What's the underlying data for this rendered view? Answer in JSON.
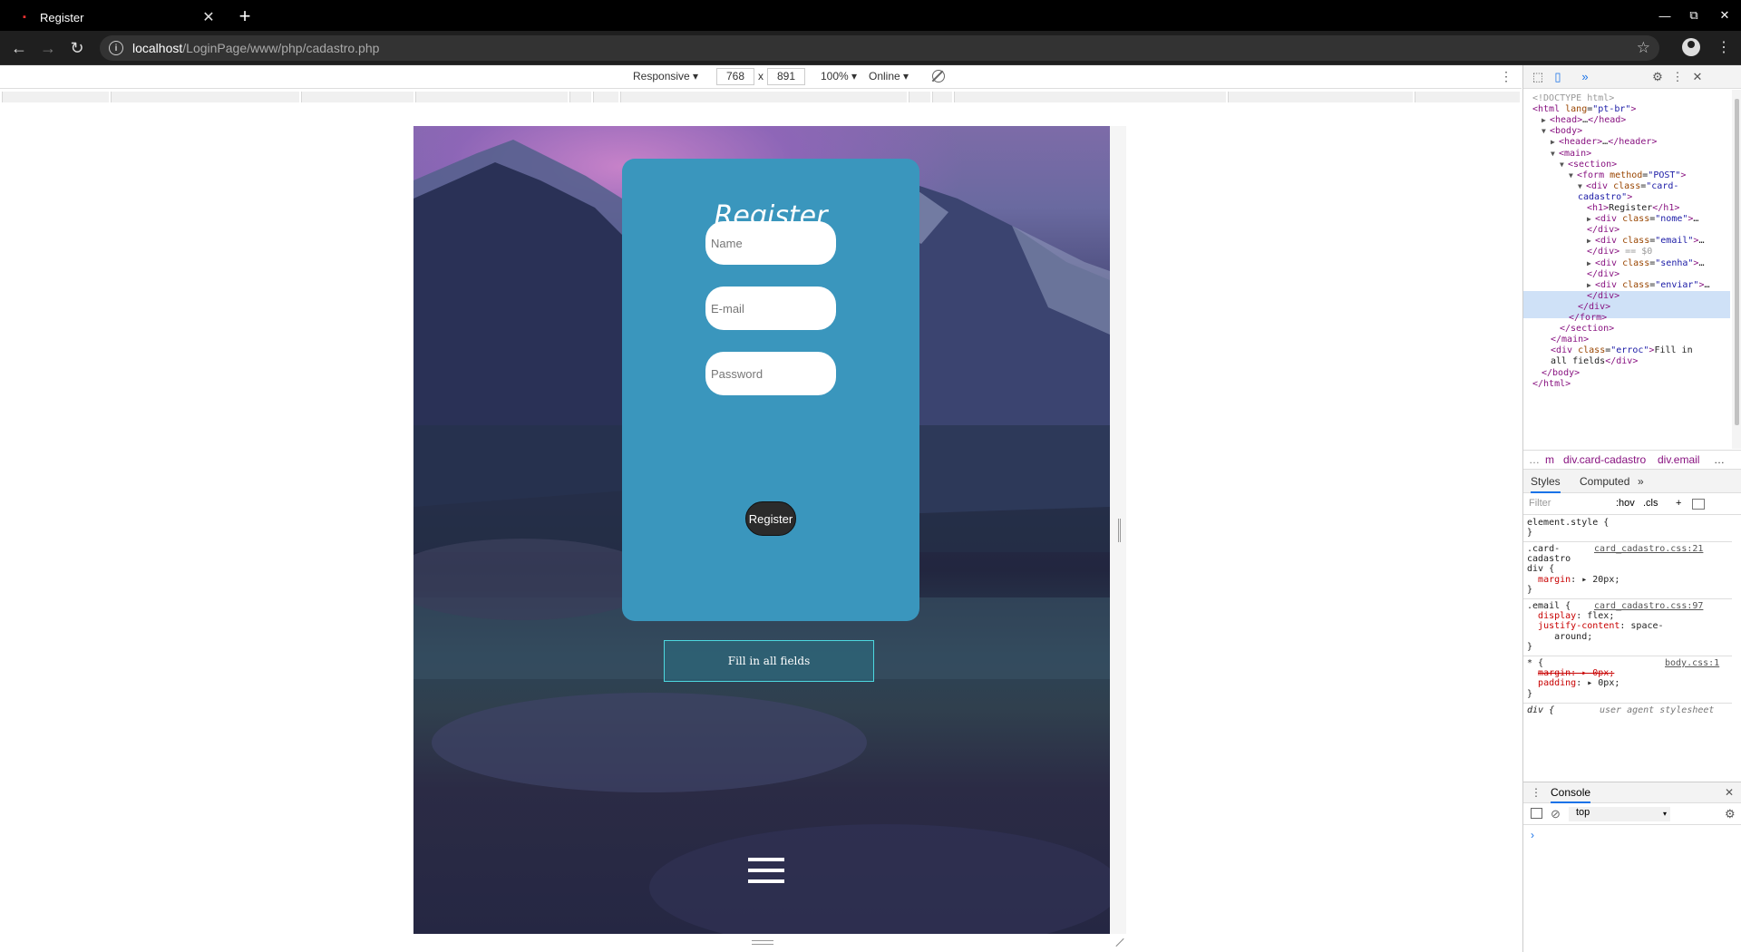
{
  "browser": {
    "tab_title": "Register",
    "tab_close": "✕",
    "new_tab": "+",
    "url_host": "localhost",
    "url_path": "/LoginPage/www/php/cadastro.php",
    "win_min": "—",
    "win_restore": "⧉",
    "win_close": "✕"
  },
  "device_toolbar": {
    "device": "Responsive ▾",
    "width": "768",
    "times": "x",
    "height": "891",
    "zoom": "100% ▾",
    "network": "Online ▾"
  },
  "page": {
    "heading": "Register",
    "name_placeholder": "Name",
    "email_placeholder": "E-mail",
    "password_placeholder": "Password",
    "submit_label": "Register",
    "error_message": "Fill in all fields"
  },
  "devtools": {
    "dom": [
      {
        "indent": 0,
        "html": "<span class=\"cmt\">&lt;!DOCTYPE html&gt;</span>"
      },
      {
        "indent": 0,
        "html": "<span class=\"tag\">&lt;html</span> <span class=\"attr\">lang</span>=<span class=\"val\">\"pt-br\"</span><span class=\"tag\">&gt;</span>"
      },
      {
        "indent": 1,
        "html": "<span class=\"tri\">▶</span><span class=\"tag\">&lt;head&gt;</span>…<span class=\"tag\">&lt;/head&gt;</span>"
      },
      {
        "indent": 1,
        "html": "<span class=\"tri\">▼</span><span class=\"tag\">&lt;body&gt;</span>"
      },
      {
        "indent": 2,
        "html": "<span class=\"tri\">▶</span><span class=\"tag\">&lt;header&gt;</span>…<span class=\"tag\">&lt;/header&gt;</span>"
      },
      {
        "indent": 2,
        "html": "<span class=\"tri\">▼</span><span class=\"tag\">&lt;main&gt;</span>"
      },
      {
        "indent": 3,
        "html": "<span class=\"tri\">▼</span><span class=\"tag\">&lt;section&gt;</span>"
      },
      {
        "indent": 4,
        "html": "<span class=\"tri\">▼</span><span class=\"tag\">&lt;form</span> <span class=\"attr\">method</span>=<span class=\"val\">\"POST\"</span><span class=\"tag\">&gt;</span>"
      },
      {
        "indent": 5,
        "html": "<span class=\"tri\">▼</span><span class=\"tag\">&lt;div</span> <span class=\"attr\">class</span>=<span class=\"val\">\"card-</span>"
      },
      {
        "indent": 5,
        "html": "<span class=\"val\">cadastro\"</span><span class=\"tag\">&gt;</span>"
      },
      {
        "indent": 6,
        "html": "<span class=\"tag\">&lt;h1&gt;</span>Register<span class=\"tag\">&lt;/h1&gt;</span>"
      },
      {
        "indent": 6,
        "html": "<span class=\"tri\">▶</span><span class=\"tag\">&lt;div</span> <span class=\"attr\">class</span>=<span class=\"val\">\"nome\"</span><span class=\"tag\">&gt;</span>…"
      },
      {
        "indent": 6,
        "html": "<span class=\"tag\">&lt;/div&gt;</span>"
      },
      {
        "indent": 6,
        "html": "<span class=\"tri\">▶</span><span class=\"tag\">&lt;div</span> <span class=\"attr\">class</span>=<span class=\"val\">\"email\"</span><span class=\"tag\">&gt;</span>…"
      },
      {
        "indent": 6,
        "html": "<span class=\"tag\">&lt;/div&gt;</span> <span class=\"cmt\">== $0</span>"
      },
      {
        "indent": 6,
        "html": "<span class=\"tri\">▶</span><span class=\"tag\">&lt;div</span> <span class=\"attr\">class</span>=<span class=\"val\">\"senha\"</span><span class=\"tag\">&gt;</span>…"
      },
      {
        "indent": 6,
        "html": "<span class=\"tag\">&lt;/div&gt;</span>"
      },
      {
        "indent": 6,
        "html": "<span class=\"tri\">▶</span><span class=\"tag\">&lt;div</span> <span class=\"attr\">class</span>=<span class=\"val\">\"enviar\"</span><span class=\"tag\">&gt;</span>…"
      },
      {
        "indent": 6,
        "html": "<span class=\"tag\">&lt;/div&gt;</span>"
      },
      {
        "indent": 5,
        "html": "<span class=\"tag\">&lt;/div&gt;</span>"
      },
      {
        "indent": 4,
        "html": "<span class=\"tag\">&lt;/form&gt;</span>"
      },
      {
        "indent": 3,
        "html": "<span class=\"tag\">&lt;/section&gt;</span>"
      },
      {
        "indent": 2,
        "html": "<span class=\"tag\">&lt;/main&gt;</span>"
      },
      {
        "indent": 2,
        "html": "<span class=\"tag\">&lt;div</span> <span class=\"attr\">class</span>=<span class=\"val\">\"erroc\"</span><span class=\"tag\">&gt;</span>Fill in"
      },
      {
        "indent": 2,
        "html": "all fields<span class=\"tag\">&lt;/div&gt;</span>"
      },
      {
        "indent": 1,
        "html": "<span class=\"tag\">&lt;/body&gt;</span>"
      },
      {
        "indent": 0,
        "html": "<span class=\"tag\">&lt;/html&gt;</span>"
      }
    ],
    "crumbs": {
      "dots": "…",
      "m": "m",
      "card": "div.card-cadastro",
      "email": "div.email",
      "more": "…"
    },
    "tabs": {
      "styles": "Styles",
      "computed": "Computed",
      "more": "»"
    },
    "filter": {
      "placeholder": "Filter",
      "hov": ":hov",
      "cls": ".cls",
      "plus": "+"
    },
    "console": {
      "title": "Console",
      "context": "top",
      "close": "✕"
    }
  }
}
